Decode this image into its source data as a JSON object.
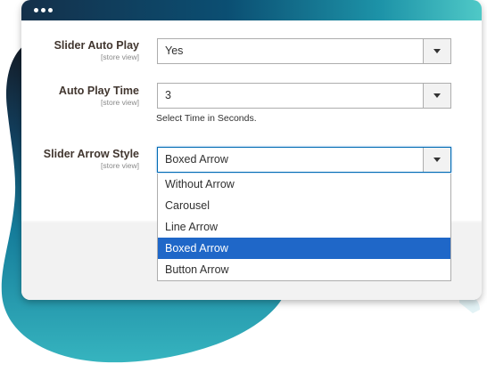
{
  "window": {
    "dots": [
      "dot",
      "dot",
      "dot"
    ]
  },
  "fields": {
    "autoplay": {
      "label": "Slider Auto Play",
      "scope": "[store view]",
      "value": "Yes"
    },
    "autoplay_time": {
      "label": "Auto Play Time",
      "scope": "[store view]",
      "value": "3",
      "hint": "Select Time in Seconds."
    },
    "arrow_style": {
      "label": "Slider Arrow Style",
      "scope": "[store view]",
      "value": "Boxed Arrow",
      "options": [
        "Without Arrow",
        "Carousel",
        "Line Arrow",
        "Boxed Arrow",
        "Button Arrow"
      ],
      "selected_option": "Boxed Arrow"
    }
  },
  "colors": {
    "selected_option_bg": "#1f67c8",
    "titlebar_gradient": [
      "#14304a",
      "#0b4f73",
      "#1d93a8",
      "#4fc9c7"
    ]
  },
  "icons": {
    "select_caret": "chevron-down-icon"
  }
}
